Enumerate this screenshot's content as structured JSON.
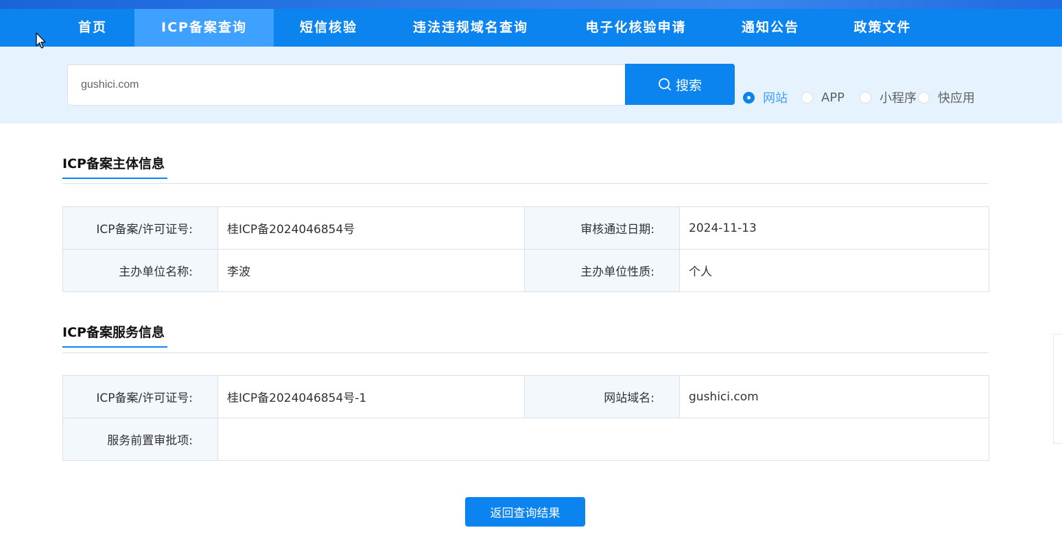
{
  "nav": {
    "items": [
      {
        "label": "首页"
      },
      {
        "label": "ICP备案查询"
      },
      {
        "label": "短信核验"
      },
      {
        "label": "违法违规域名查询"
      },
      {
        "label": "电子化核验申请"
      },
      {
        "label": "通知公告"
      },
      {
        "label": "政策文件"
      }
    ],
    "active_index": 1
  },
  "search": {
    "value": "gushici.com",
    "button_label": "搜索",
    "button_icon": "search-icon",
    "types": [
      {
        "label": "网站",
        "checked": true
      },
      {
        "label": "APP",
        "checked": false
      },
      {
        "label": "小程序",
        "checked": false
      },
      {
        "label": "快应用",
        "checked": false
      }
    ]
  },
  "subject": {
    "title": "ICP备案主体信息",
    "rows": [
      {
        "label1": "ICP备案/许可证号:",
        "value1": "桂ICP备2024046854号",
        "label2": "审核通过日期:",
        "value2": "2024-11-13"
      },
      {
        "label1": "主办单位名称:",
        "value1": "李波",
        "label2": "主办单位性质:",
        "value2": "个人"
      }
    ]
  },
  "service": {
    "title": "ICP备案服务信息",
    "row1": {
      "label1": "ICP备案/许可证号:",
      "value1": "桂ICP备2024046854号-1",
      "label2": "网站域名:",
      "value2": "gushici.com"
    },
    "row2": {
      "label": "服务前置审批项:",
      "value": ""
    }
  },
  "back_button": {
    "label": "返回查询结果"
  },
  "colors": {
    "primary": "#0b84f0",
    "nav_active": "#3ea1ff",
    "band": "#e6f2fd",
    "label_bg": "#f3f8fd"
  }
}
